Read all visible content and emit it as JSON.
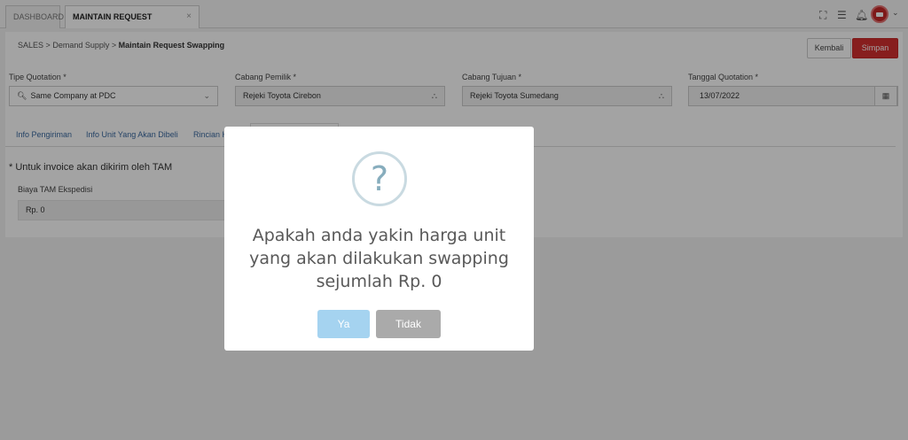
{
  "tabs": [
    {
      "label": "DASHBOARD"
    },
    {
      "label": "MAINTAIN REQUEST SWAPPING",
      "close": "×"
    }
  ],
  "topbar": {
    "icons": [
      "fullscreen-icon",
      "menu-icon",
      "bell-icon"
    ],
    "user_avatar_color": "#c62828"
  },
  "breadcrumb": {
    "part1": "SALES",
    "sep": ">",
    "part2": "Demand Supply",
    "part3": "Maintain Request Swapping"
  },
  "actions": {
    "kembali": "Kembali",
    "simpan": "Simpan",
    "simpan_color": "#d32f2f"
  },
  "form": {
    "tipe_quotation": {
      "label": "Tipe Quotation *",
      "value": "Same Company at PDC"
    },
    "cabang_pemilik": {
      "label": "Cabang Pemilik *",
      "value": "Rejeki Toyota Cirebon"
    },
    "cabang_tujuan": {
      "label": "Cabang Tujuan *",
      "value": "Rejeki Toyota Sumedang"
    },
    "tanggal_quotation": {
      "label": "Tanggal Quotation *",
      "value": "13/07/2022"
    }
  },
  "subtabs": [
    "Info Pengiriman",
    "Info Unit Yang Akan Dibeli",
    "Rincian H"
  ],
  "note": "* Untuk invoice akan dikirim oleh TAM",
  "biaya": {
    "label": "Biaya TAM Ekspedisi",
    "value": "Rp. 0"
  },
  "modal": {
    "icon": "?",
    "line1": "Apakah anda yakin harga unit",
    "line2": "yang akan dilakukan swapping",
    "line3": "sejumlah Rp. 0",
    "confirm": "Ya",
    "cancel": "Tidak",
    "confirm_color": "#a5d3f0",
    "cancel_color": "#aaaaaa"
  }
}
